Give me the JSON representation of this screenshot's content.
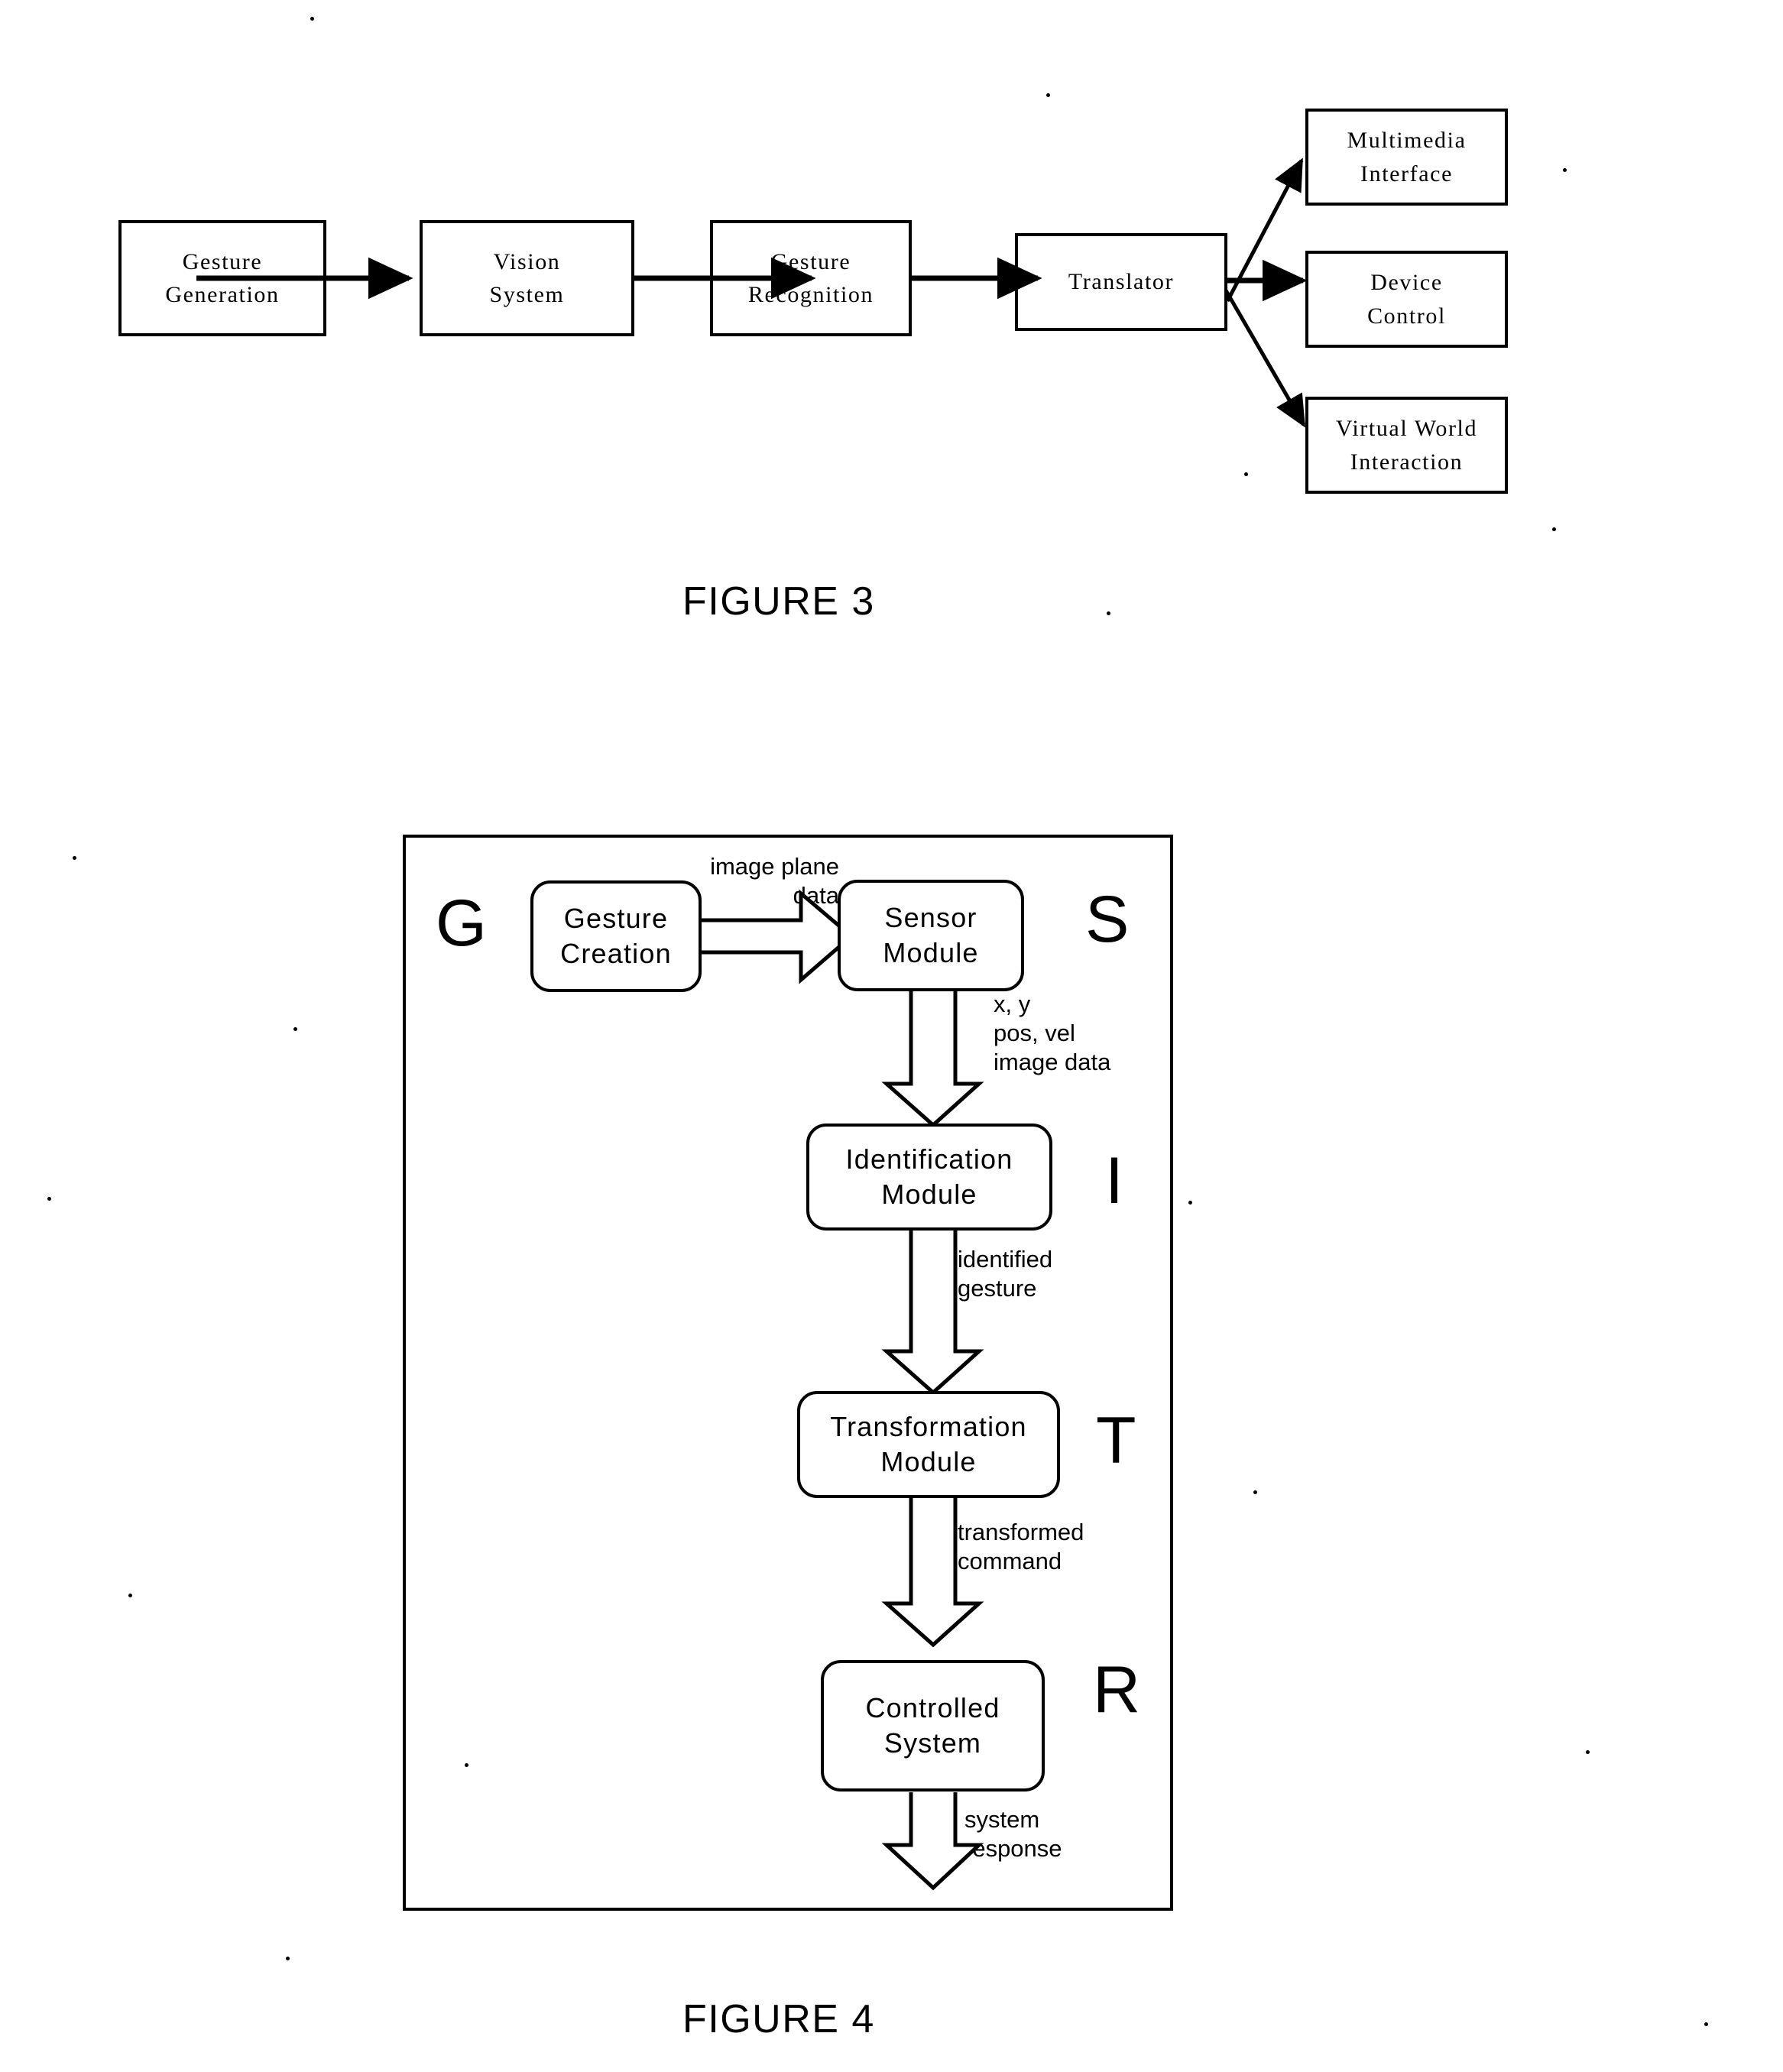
{
  "document": {
    "kind": "patent-drawing-sheet",
    "background_color": "#ffffff",
    "ink_color": "#000000"
  },
  "figure3": {
    "caption": "FIGURE 3",
    "boxes": [
      {
        "id": "gesture-generation",
        "lines": [
          "Gesture",
          "Generation"
        ]
      },
      {
        "id": "vision-system",
        "lines": [
          "Vision",
          "System"
        ]
      },
      {
        "id": "gesture-recognition",
        "lines": [
          "Gesture",
          "Recognition"
        ]
      },
      {
        "id": "translator",
        "lines": [
          "Translator"
        ]
      },
      {
        "id": "multimedia-interface",
        "lines": [
          "Multimedia",
          "Interface"
        ]
      },
      {
        "id": "device-control",
        "lines": [
          "Device",
          "Control"
        ]
      },
      {
        "id": "virtual-world-interaction",
        "lines": [
          "Virtual World",
          "Interaction"
        ]
      }
    ],
    "flow": [
      {
        "from": "gesture-generation",
        "to": "vision-system"
      },
      {
        "from": "vision-system",
        "to": "gesture-recognition"
      },
      {
        "from": "gesture-recognition",
        "to": "translator"
      },
      {
        "from": "translator",
        "to": "multimedia-interface"
      },
      {
        "from": "translator",
        "to": "device-control"
      },
      {
        "from": "translator",
        "to": "virtual-world-interaction"
      }
    ]
  },
  "figure4": {
    "caption": "FIGURE 4",
    "letters": [
      {
        "id": "letter-g",
        "text": "G"
      },
      {
        "id": "letter-s",
        "text": "S"
      },
      {
        "id": "letter-i",
        "text": "I"
      },
      {
        "id": "letter-t",
        "text": "T"
      },
      {
        "id": "letter-r",
        "text": "R"
      }
    ],
    "nodes": [
      {
        "id": "gesture-creation",
        "lines": [
          "Gesture",
          "Creation"
        ]
      },
      {
        "id": "sensor-module",
        "lines": [
          "Sensor",
          "Module"
        ]
      },
      {
        "id": "identification-module",
        "lines": [
          "Identification",
          "Module"
        ]
      },
      {
        "id": "transformation-module",
        "lines": [
          "Transformation",
          "Module"
        ]
      },
      {
        "id": "controlled-system",
        "lines": [
          "Controlled",
          "System"
        ]
      }
    ],
    "edge_labels": [
      {
        "id": "image-plane-data",
        "lines": [
          "image plane",
          "data"
        ]
      },
      {
        "id": "xy-pos-vel-image-data",
        "lines": [
          "x, y",
          "pos, vel",
          "image data"
        ]
      },
      {
        "id": "identified-gesture",
        "lines": [
          "identified",
          "gesture"
        ]
      },
      {
        "id": "transformed-command",
        "lines": [
          "transformed",
          "command"
        ]
      },
      {
        "id": "system-response",
        "lines": [
          "system",
          "response"
        ]
      }
    ],
    "flow": [
      {
        "from": "gesture-creation",
        "to": "sensor-module",
        "label": "image-plane-data"
      },
      {
        "from": "sensor-module",
        "to": "identification-module",
        "label": "xy-pos-vel-image-data"
      },
      {
        "from": "identification-module",
        "to": "transformation-module",
        "label": "identified-gesture"
      },
      {
        "from": "transformation-module",
        "to": "controlled-system",
        "label": "transformed-command"
      },
      {
        "from": "controlled-system",
        "to": "output",
        "label": "system-response"
      }
    ]
  }
}
